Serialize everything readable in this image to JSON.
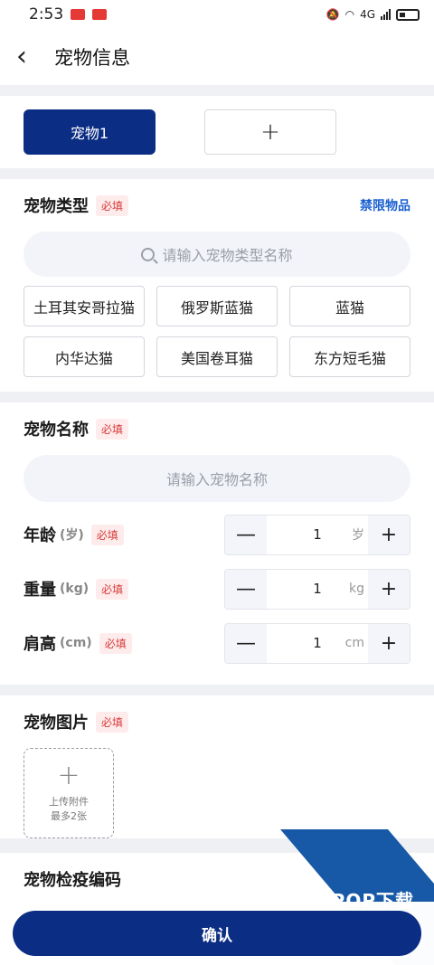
{
  "status": {
    "time": "2:53",
    "network": "4G"
  },
  "header": {
    "title": "宠物信息"
  },
  "tabs": {
    "pet1": "宠物1",
    "add": "+"
  },
  "pet_type": {
    "title": "宠物类型",
    "required": "必填",
    "restricted_link": "禁限物品",
    "search_placeholder": "请输入宠物类型名称",
    "types": [
      "土耳其安哥拉猫",
      "俄罗斯蓝猫",
      "蓝猫",
      "内华达猫",
      "美国卷耳猫",
      "东方短毛猫"
    ]
  },
  "pet_name": {
    "title": "宠物名称",
    "required": "必填",
    "placeholder": "请输入宠物名称"
  },
  "age": {
    "label": "年龄",
    "unit_hint": "(岁)",
    "required": "必填",
    "value": "1",
    "unit": "岁"
  },
  "weight": {
    "label": "重量",
    "unit_hint": "(kg)",
    "required": "必填",
    "value": "1",
    "unit": "kg"
  },
  "height": {
    "label": "肩高",
    "unit_hint": "(cm)",
    "required": "必填",
    "value": "1",
    "unit": "cm"
  },
  "stepper": {
    "minus": "—",
    "plus": "+"
  },
  "pet_image": {
    "title": "宠物图片",
    "required": "必填",
    "upload_line1": "上传附件",
    "upload_line2": "最多2张",
    "upload_plus": "+"
  },
  "quarantine": {
    "title": "宠物检疫编码"
  },
  "footer": {
    "confirm": "确认"
  },
  "watermark": {
    "text": "PCPOP下载"
  }
}
